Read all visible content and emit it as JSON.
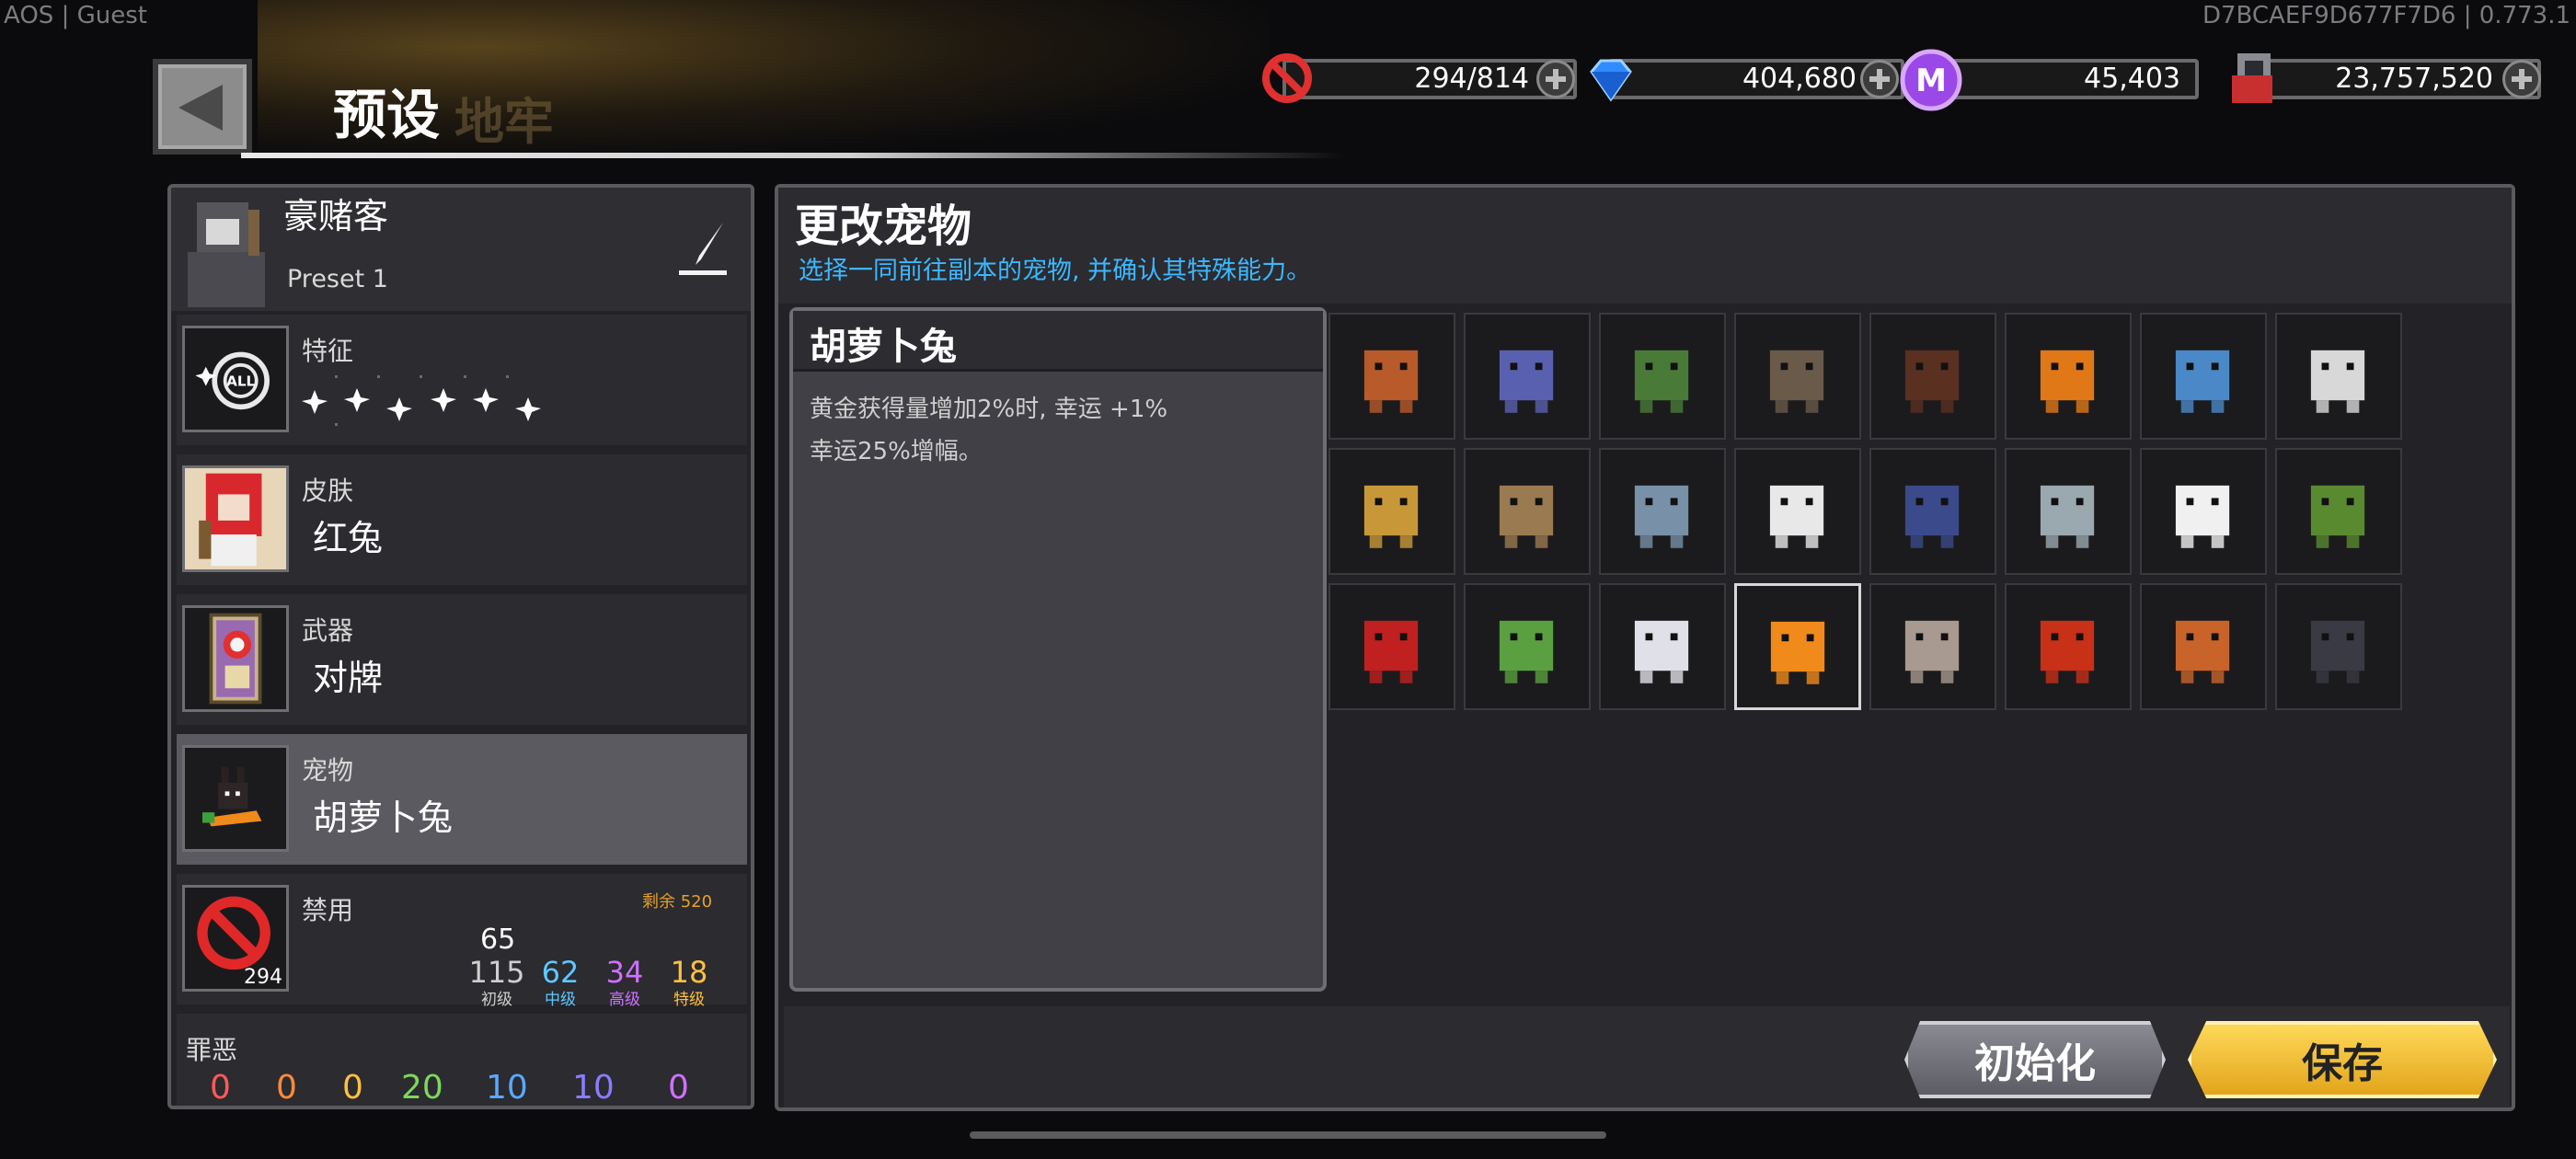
{
  "system": {
    "left": "AOS | Guest",
    "right": "D7BCAEF9D677F7D6 | 0.773.1"
  },
  "header": {
    "title": "预设",
    "ghost_title": "地牢"
  },
  "resources": [
    {
      "icon": "ban-icon",
      "value": "294/814"
    },
    {
      "icon": "diamond-icon",
      "value": "404,680"
    },
    {
      "icon": "m-coin-icon",
      "value": "45,403"
    },
    {
      "icon": "character-coin-icon",
      "value": "23,757,520"
    }
  ],
  "preset": {
    "character": "豪赌客",
    "name": "Preset 1"
  },
  "slots": {
    "trait": {
      "label": "特征"
    },
    "skin": {
      "label": "皮肤",
      "value": "红兔"
    },
    "weapon": {
      "label": "武器",
      "value": "对牌"
    },
    "pet": {
      "label": "宠物",
      "value": "胡萝卜兔"
    },
    "ban": {
      "label": "禁用",
      "badge": "294",
      "remaining": "剩余 520",
      "total": "65",
      "tiers": [
        {
          "value": "115",
          "label": "初级",
          "color": "#cfcfcf"
        },
        {
          "value": "62",
          "label": "中级",
          "color": "#5ec8ff"
        },
        {
          "value": "34",
          "label": "高级",
          "color": "#d070ff"
        },
        {
          "value": "18",
          "label": "特级",
          "color": "#ffc040"
        }
      ]
    },
    "sin": {
      "label": "罪恶",
      "values": [
        "0",
        "0",
        "0",
        "20",
        "10",
        "10",
        "0"
      ],
      "colors": [
        "#ff5a5a",
        "#ff8a3a",
        "#ffc040",
        "#7cd85a",
        "#5aa8ff",
        "#8a7cff",
        "#d070ff"
      ]
    }
  },
  "pet_panel": {
    "title": "更改宠物",
    "subtitle": "选择一同前往副本的宠物, 并确认其特殊能力。",
    "selected_name": "胡萝卜兔",
    "description_line1": "黄金获得量增加2%时, 幸运 +1%",
    "description_line2": "幸运25%增幅。"
  },
  "pets": [
    "squirrel",
    "hooded-wizard",
    "mandrake",
    "stone-golem",
    "treasure-chest",
    "pumpkin",
    "diver",
    "white-fox",
    "sheriff-star",
    "eagle",
    "shark",
    "santa-cat",
    "blue-dragon",
    "sleeping-seal",
    "snowman",
    "goblin-pumpkin",
    "reaper",
    "snail",
    "white-fairy",
    "carrot-rabbit",
    "ghost-cat",
    "red-serpent",
    "hermit-crab",
    "shadow-bat"
  ],
  "selected_pet_index": 19,
  "buttons": {
    "reset": "初始化",
    "save": "保存"
  },
  "colors": {
    "accent_blue": "#3cb8ff",
    "save_gold": "#f6c23a",
    "panel": "#232327"
  }
}
